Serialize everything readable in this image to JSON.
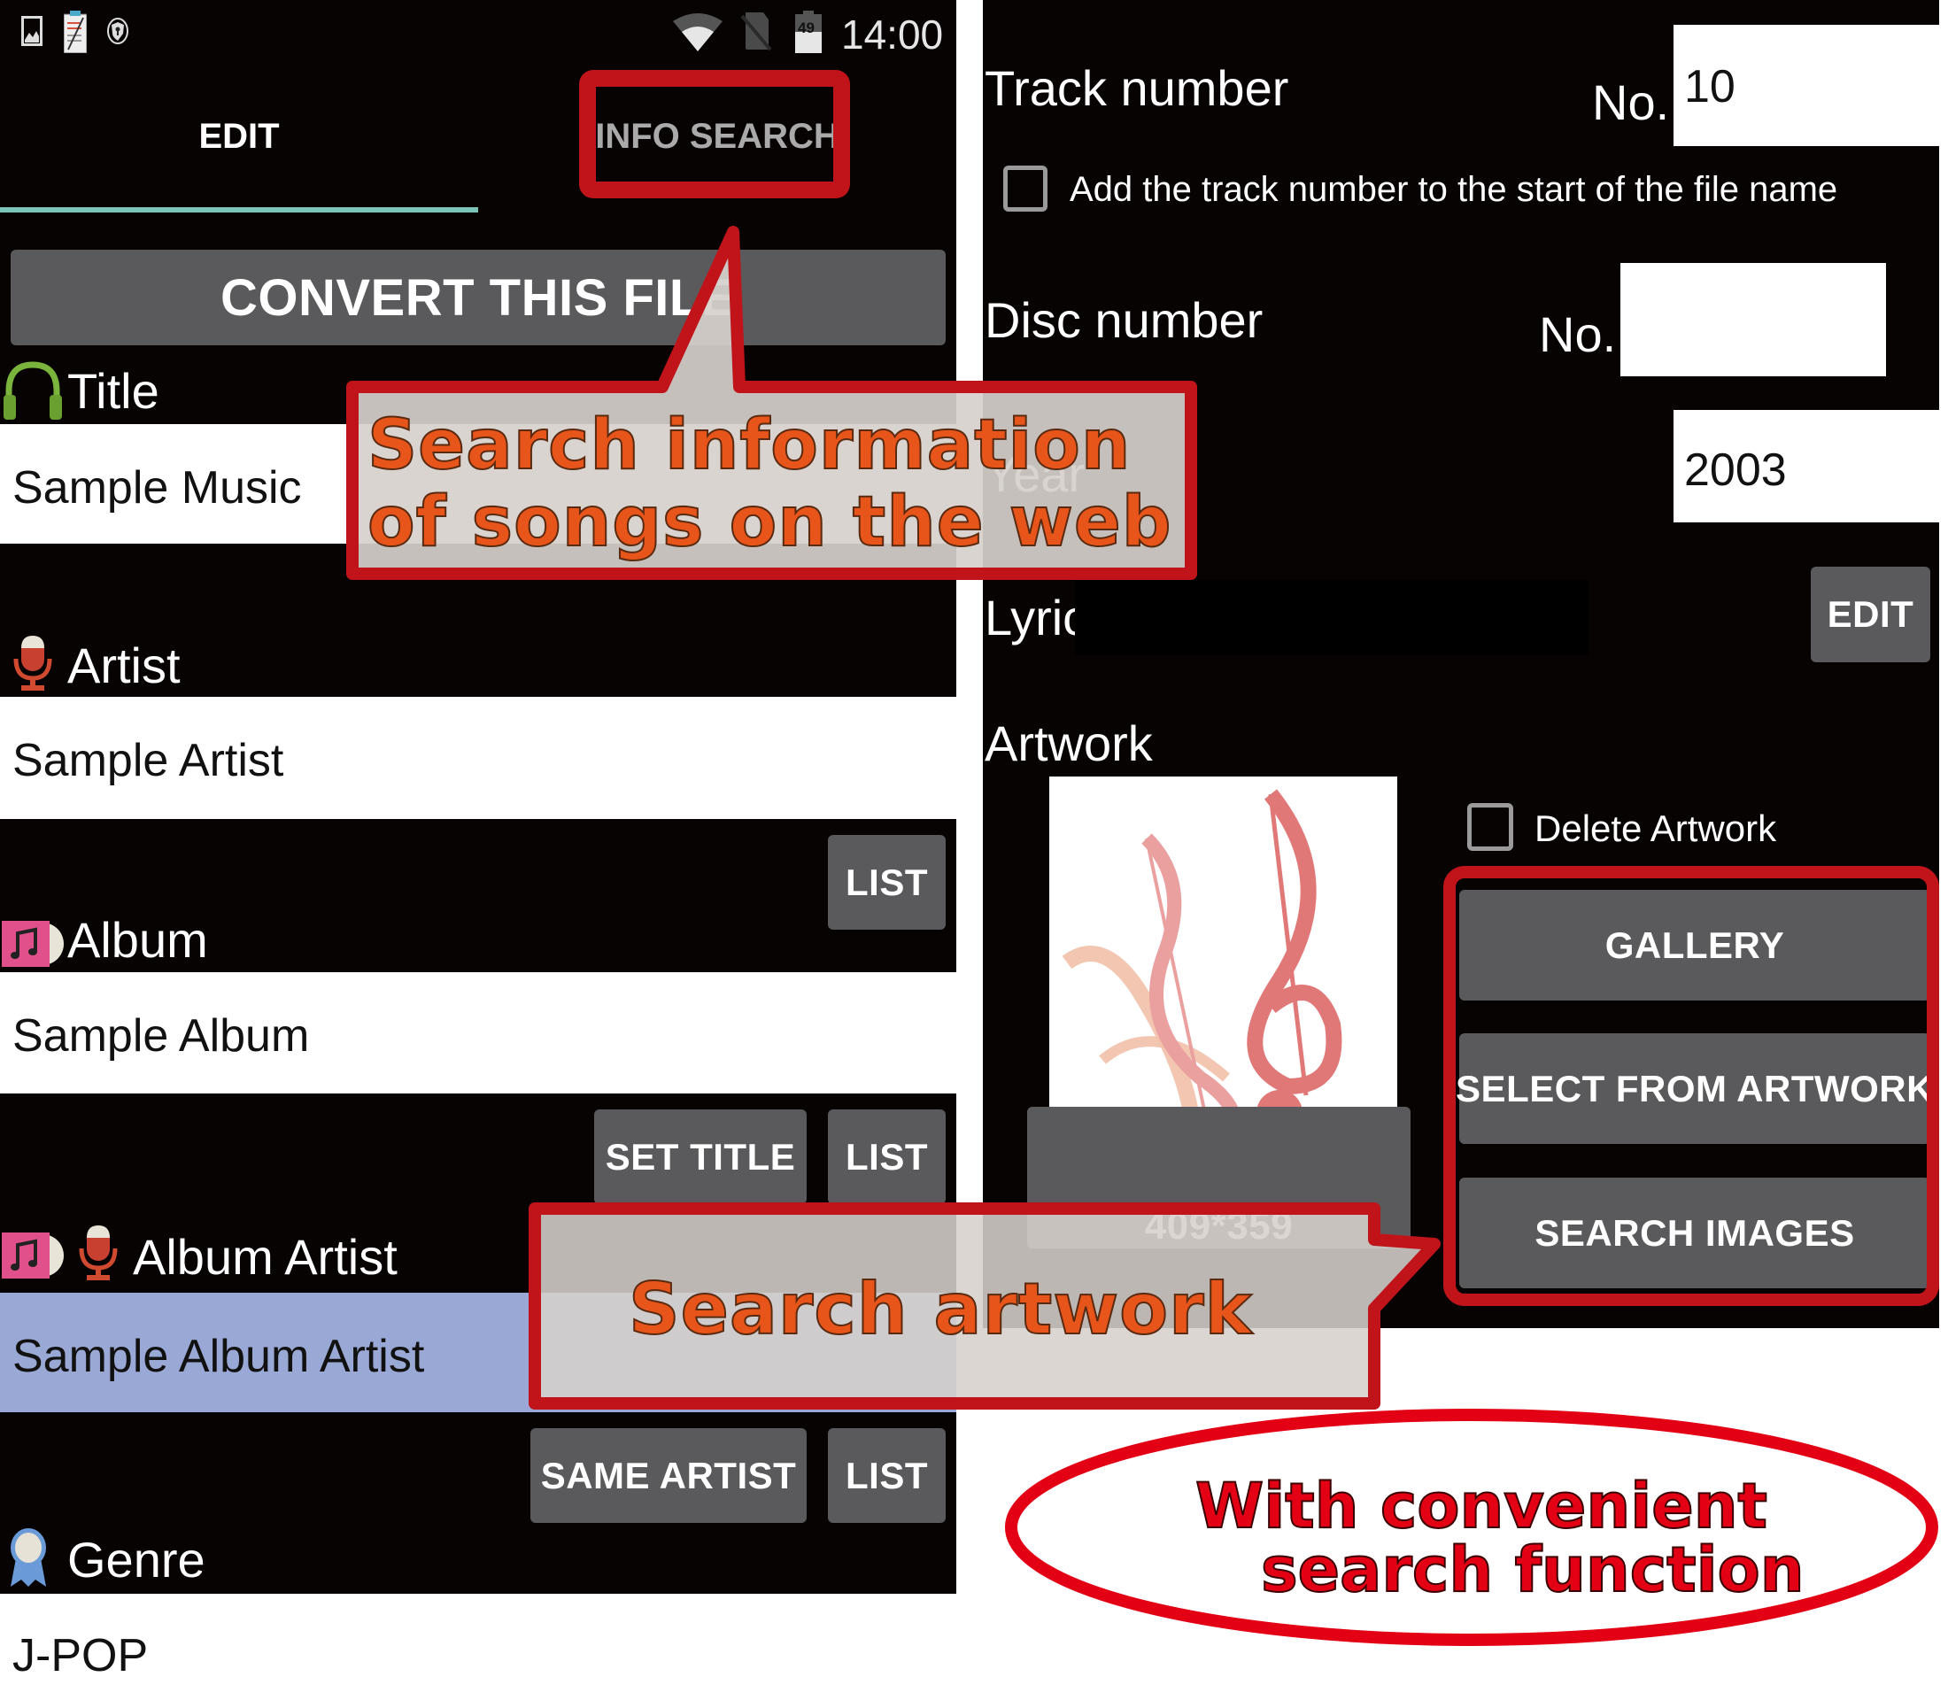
{
  "status_bar": {
    "left_icons": [
      "image-icon",
      "clipboard-icon",
      "shield-key-icon"
    ],
    "right_icons": [
      "wifi-icon",
      "no-sim-icon",
      "battery-icon"
    ],
    "battery_level": "49",
    "time": "14:00"
  },
  "tabs": [
    {
      "label": "EDIT",
      "active": true
    },
    {
      "label": "INFO SEARCH",
      "active": false
    }
  ],
  "convert_button": "CONVERT THIS FILE",
  "fields": {
    "title": {
      "label": "Title",
      "value": "Sample Music"
    },
    "artist": {
      "label": "Artist",
      "value": "Sample Artist"
    },
    "album": {
      "label": "Album",
      "value": "Sample Album",
      "buttons": [
        "LIST"
      ]
    },
    "album_artist": {
      "label": "Album Artist",
      "value": "Sample Album Artist",
      "buttons": [
        "SET TITLE",
        "LIST"
      ]
    },
    "genre": {
      "label": "Genre",
      "value": "J-POP",
      "buttons": [
        "SAME ARTIST",
        "LIST"
      ]
    }
  },
  "right_panel": {
    "track": {
      "label": "Track number",
      "prefix": "No.",
      "value": "10"
    },
    "track_checkbox": {
      "label": "Add the track number to the start of the file name",
      "checked": false
    },
    "disc": {
      "label": "Disc number",
      "prefix": "No.",
      "value": ""
    },
    "year": {
      "label": "Year",
      "value": "2003"
    },
    "lyrics": {
      "label": "Lyrics",
      "value": "",
      "edit_button": "EDIT"
    },
    "artwork": {
      "label": "Artwork",
      "size": "409*359",
      "delete_checkbox": {
        "label": "Delete Artwork",
        "checked": false
      },
      "buttons": [
        "GALLERY",
        "SELECT FROM ARTWORK",
        "SEARCH IMAGES"
      ]
    }
  },
  "annotations": {
    "callout_info": [
      "Search information",
      "of songs on the web"
    ],
    "callout_artwork": "Search artwork",
    "oval": [
      "With convenient",
      "search function"
    ]
  },
  "colors": {
    "highlight_red": "#c0141a",
    "callout_text": "#e8551a",
    "oval_red": "#e30014",
    "tab_indicator": "#7cc4b8",
    "album_artist_field": "#9aa8d6"
  }
}
